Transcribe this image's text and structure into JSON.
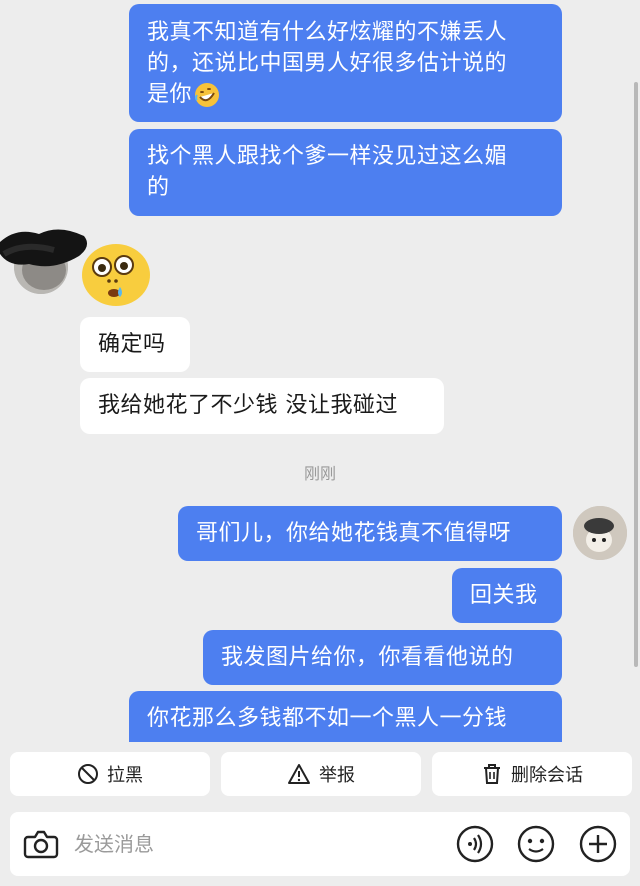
{
  "messages": [
    {
      "side": "out",
      "text": "我真不知道有什么好炫耀的不嫌丢人的，还说比中国男人好很多估计说的是你🤣"
    },
    {
      "side": "out",
      "text": "找个黑人跟找个爹一样没见过这么媚的"
    },
    {
      "side": "in",
      "text": "确定吗"
    },
    {
      "side": "in",
      "text": "我给她花了不少钱 没让我碰过"
    },
    {
      "side": "out",
      "text": "哥们儿，你给她花钱真不值得呀"
    },
    {
      "side": "out",
      "text": "回关我"
    },
    {
      "side": "out",
      "text": "我发图片给你，你看看他说的"
    },
    {
      "side": "out",
      "text": "你花那么多钱都不如一个黑人一分钱"
    }
  ],
  "msg1_line1": "我真不知道有什么好炫耀的不嫌丢人",
  "msg1_line2": "的，还说比中国男人好很多估计说的",
  "msg1_line3": "是你",
  "msg2_line1": "找个黑人跟找个爹一样没见过这么媚",
  "msg2_line2": "的",
  "timestamp": "刚刚",
  "actions": {
    "block": "拉黑",
    "report": "举报",
    "delete": "删除会话"
  },
  "input": {
    "placeholder": "发送消息"
  },
  "icons": {
    "camera": "camera-icon",
    "voice": "voice-icon",
    "emoji": "emoji-icon",
    "plus": "plus-icon",
    "block": "block-icon",
    "report": "warning-icon",
    "delete": "trash-icon"
  },
  "colors": {
    "outgoing_bubble": "#4d7ff0",
    "incoming_bubble": "#ffffff",
    "background": "#ededed"
  }
}
